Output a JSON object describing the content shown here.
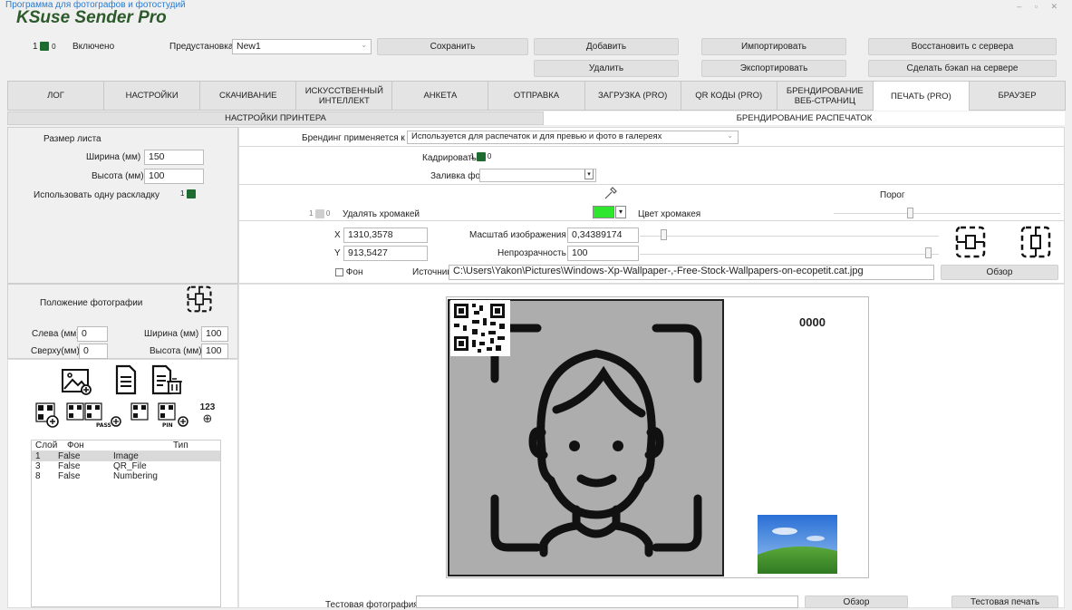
{
  "top_link": "Программа для фотографов и фотостудий",
  "app_title": "KSuse Sender Pro",
  "window_controls": "–  ▫  ✕",
  "header": {
    "toggle_on": "1",
    "toggle_off": "0",
    "enabled_label": "Включено",
    "preset_label": "Предустановка",
    "preset_value": "New1",
    "save": "Сохранить",
    "add": "Добавить",
    "delete": "Удалить",
    "import": "Импортировать",
    "export": "Экспортировать",
    "restore_server": "Восстановить с сервера",
    "backup_server": "Сделать бэкап на сервере"
  },
  "tabs": [
    "ЛОГ",
    "НАСТРОЙКИ",
    "СКАЧИВАНИЕ",
    "ИСКУССТВЕННЫЙ ИНТЕЛЛЕКТ",
    "АНКЕТА",
    "ОТПРАВКА",
    "ЗАГРУЗКА (PRO)",
    "QR КОДЫ (PRO)",
    "БРЕНДИРОВАНИЕ ВЕБ-СТРАНИЦ",
    "ПЕЧАТЬ (PRO)",
    "БРАУЗЕР"
  ],
  "active_tab": "ПЕЧАТЬ (PRO)",
  "subtabs": {
    "printer": "НАСТРОЙКИ ПРИНТЕРА",
    "branding": "БРЕНДИРОВАНИЕ РАСПЕЧАТОК"
  },
  "sheet": {
    "title": "Размер листа",
    "width_label": "Ширина (мм)",
    "width_value": "150",
    "height_label": "Высота (мм)",
    "height_value": "100",
    "single_layout_label": "Использовать одну раскладку"
  },
  "branding": {
    "applies_label": "Брендинг применяется к",
    "applies_value": "Используется для распечаток и для превью и фото в галереях",
    "crop_label": "Кадрировать",
    "fill_label": "Заливка фона",
    "threshold_label": "Порог",
    "chroma_remove_label": "Удалять хромакей",
    "chroma_color_label": "Цвет хромакея",
    "chroma_color": "#2ee62e",
    "x_label": "X",
    "x_value": "1310,3578",
    "y_label": "Y",
    "y_value": "913,5427",
    "scale_label": "Масштаб изображения",
    "scale_value": "0,34389174",
    "opacity_label": "Непрозрачность",
    "opacity_value": "100",
    "bg_check_label": "Фон",
    "source_label": "Источник",
    "source_value": "C:\\Users\\Yakon\\Pictures\\Windows-Xp-Wallpaper-,-Free-Stock-Wallpapers-on-ecopetit.cat.jpg",
    "browse": "Обзор"
  },
  "photo_position": {
    "title": "Положение фотографии",
    "left_label": "Слева (мм)",
    "left_value": "0",
    "top_label": "Сверху(мм)",
    "top_value": "0",
    "width_label": "Ширина (мм)",
    "width_value": "100",
    "height_label": "Высота (мм)",
    "height_value": "100"
  },
  "numbering_icon_text": "123",
  "layers": {
    "headers": [
      "Слой",
      "Фон",
      "Тип"
    ],
    "rows": [
      {
        "layer": "1",
        "bg": "False",
        "type": "Image"
      },
      {
        "layer": "3",
        "bg": "False",
        "type": "QR_File"
      },
      {
        "layer": "8",
        "bg": "False",
        "type": "Numbering"
      }
    ]
  },
  "preview": {
    "number": "0000"
  },
  "bottom": {
    "test_photo_label": "Тестовая фотография",
    "browse": "Обзор",
    "test_print": "Тестовая печать"
  },
  "icons": [
    "eyedropper-icon",
    "center-horizontal-icon",
    "center-vertical-icon",
    "position-center-icon",
    "add-image-icon",
    "document-icon",
    "delete-document-icon",
    "add-qr-link-icon",
    "add-qr-pass-icon",
    "add-qr-pin-icon",
    "add-numbering-icon",
    "person-portrait-icon",
    "qr-code-icon",
    "landscape-photo-icon"
  ]
}
